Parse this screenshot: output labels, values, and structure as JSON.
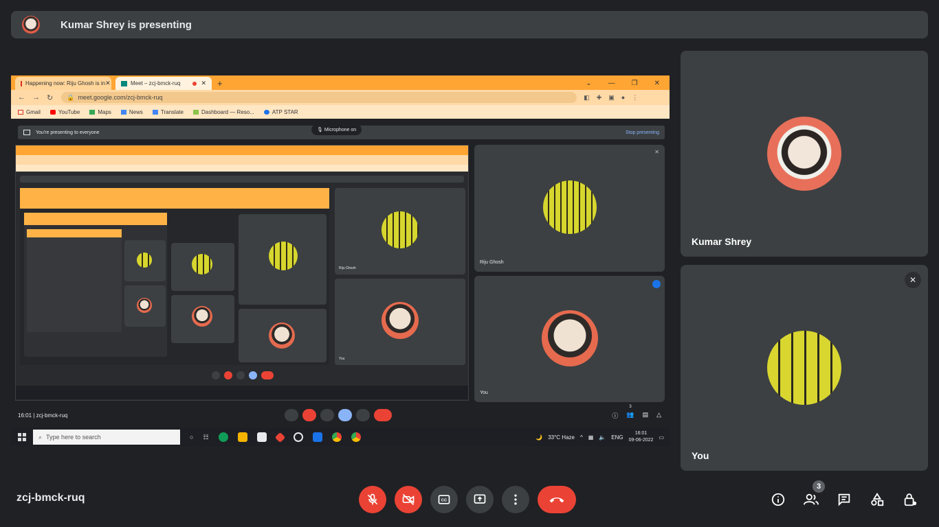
{
  "banner": {
    "presenting_text": "Kumar Shrey is presenting"
  },
  "browser": {
    "tabs": [
      {
        "label": "Happening now: Riju Ghosh is in"
      },
      {
        "label": "Meet – zcj-bmck-ruq"
      }
    ],
    "url": "meet.google.com/zcj-bmck-ruq",
    "bookmarks": [
      "Gmail",
      "YouTube",
      "Maps",
      "News",
      "Translate",
      "Dashboard — Reso...",
      "ATP STAR"
    ]
  },
  "presenting_bar": {
    "text": "You're presenting to everyone",
    "mic_pill": "Microphone on",
    "stop_label": "Stop presenting"
  },
  "inner_tiles": {
    "riju": "Riju Ghosh",
    "you": "You"
  },
  "inner_controls": {
    "time": "16:01",
    "separator": "|",
    "code": "zcj-bmck-ruq",
    "badge": "3"
  },
  "taskbar": {
    "search_placeholder": "Type here to search",
    "weather": "33°C  Haze",
    "lang": "ENG",
    "time": "16:01",
    "date": "09-06-2022"
  },
  "participants": [
    {
      "name": "Kumar Shrey"
    },
    {
      "name": "You"
    }
  ],
  "bottom": {
    "meeting_code": "zcj-bmck-ruq",
    "people_count": "3"
  },
  "colors": {
    "accent_red": "#ea4335",
    "surface": "#3c4043",
    "background": "#202124"
  }
}
